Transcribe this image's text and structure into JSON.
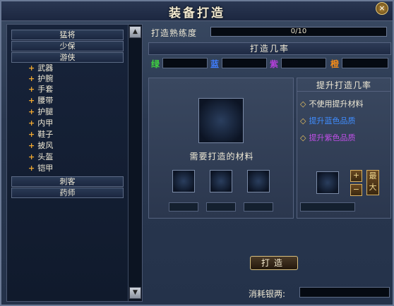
{
  "window": {
    "title": "装备打造",
    "close": "×"
  },
  "classes": {
    "top": [
      "猛将",
      "少保",
      "游侠"
    ],
    "bottom": [
      "刺客",
      "药师"
    ]
  },
  "subitems": [
    "武器",
    "护腕",
    "手套",
    "腰带",
    "护腿",
    "内甲",
    "鞋子",
    "披风",
    "头盔",
    "铠甲"
  ],
  "scroll": {
    "up": "▲",
    "down": "▼"
  },
  "proficiency": {
    "label": "打造熟练度",
    "value": "0/10",
    "progress": 0
  },
  "rate": {
    "header": "打造几率",
    "items": [
      {
        "label": "绿",
        "color": "#3fd23f"
      },
      {
        "label": "蓝",
        "color": "#3f7dff"
      },
      {
        "label": "紫",
        "color": "#b33fd9"
      },
      {
        "label": "橙",
        "color": "#f08a1a"
      }
    ]
  },
  "craft": {
    "materials_title": "需要打造的材料"
  },
  "upgrade": {
    "header": "提升打造几率",
    "options": [
      {
        "label": "不使用提升材料",
        "color": "#f0ead6"
      },
      {
        "label": "提升蓝色品质",
        "color": "#3f8dff"
      },
      {
        "label": "提升紫色品质",
        "color": "#c04fe8"
      }
    ],
    "plus": "+",
    "minus": "−",
    "max_label": "最大"
  },
  "actions": {
    "craft": "打造",
    "cost_label": "消耗银两:"
  }
}
